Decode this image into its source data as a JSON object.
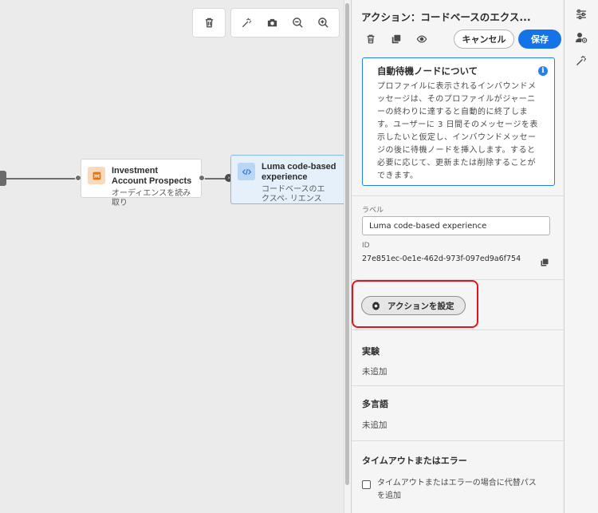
{
  "canvas": {
    "toolbar": {
      "delete": "trash-icon",
      "auto_arrange": "magic-wand-icon",
      "screenshot": "camera-icon",
      "zoom_out": "zoom-out-icon",
      "zoom_in": "zoom-in-icon"
    },
    "nodes": [
      {
        "title": "Investment Account Prospects",
        "subtitle": "オーディエンスを読み取り",
        "icon": "audience-icon",
        "icon_color": "#e8740b"
      },
      {
        "title": "Luma code-based experience",
        "subtitle": "コードベースのエクスペ- リエンス",
        "icon": "code-icon",
        "icon_color": "#2680eb"
      }
    ]
  },
  "panel": {
    "title": "アクション：コードベースのエクス...",
    "actions": {
      "delete": "trash-icon",
      "duplicate": "duplicate-icon",
      "preview": "eye-icon",
      "cancel_label": "キャンセル",
      "save_label": "保存"
    },
    "info": {
      "title": "自動待機ノードについて",
      "body": "プロファイルに表示されるインバウンドメッセージは、そのプロファイルがジャーニーの終わりに達すると自動的に終了します。ユーザーに 3 日間そのメッセージを表示したいと仮定し、インバウンドメッセージの後に待機ノードを挿入します。すると必要に応じて、更新または削除することができます。"
    },
    "label_field": {
      "label": "ラベル",
      "value": "Luma code-based experience"
    },
    "id_field": {
      "label": "ID",
      "value": "27e851ec-0e1e-462d-973f-097ed9a6f754"
    },
    "configure_action_label": "アクションを設定",
    "experiment": {
      "heading": "実験",
      "value": "未追加"
    },
    "multilingual": {
      "heading": "多言語",
      "value": "未追加"
    },
    "timeout": {
      "heading": "タイムアウトまたはエラー",
      "checkbox_label": "タイムアウトまたはエラーの場合に代替パスを追加",
      "checked": false
    }
  },
  "rail": {
    "items": [
      "settings-sliders-icon",
      "user-settings-icon",
      "magic-wand-icon"
    ]
  },
  "colors": {
    "accent": "#1473e6",
    "highlight": "#e0141e",
    "selected_bg": "#e5f0fb"
  }
}
